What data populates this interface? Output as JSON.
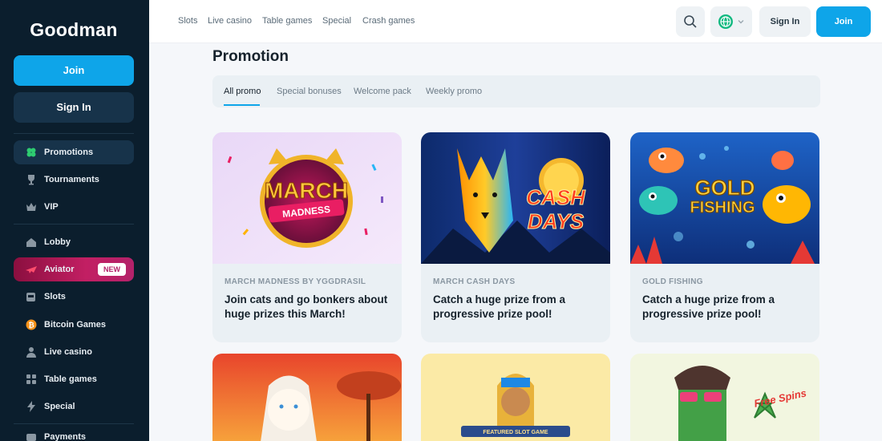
{
  "sidebar": {
    "logo": "Goodman",
    "join_label": "Join",
    "signin_label": "Sign In",
    "items": [
      {
        "label": "Promotions",
        "icon": "clover-icon"
      },
      {
        "label": "Tournaments",
        "icon": "trophy-icon"
      },
      {
        "label": "VIP",
        "icon": "crown-icon"
      },
      {
        "label": "Lobby",
        "icon": "home-icon"
      },
      {
        "label": "Aviator",
        "icon": "plane-icon",
        "badge": "NEW"
      },
      {
        "label": "Slots",
        "icon": "slot-machine-icon"
      },
      {
        "label": "Bitcoin Games",
        "icon": "bitcoin-icon"
      },
      {
        "label": "Live casino",
        "icon": "dealer-icon"
      },
      {
        "label": "Table games",
        "icon": "cards-icon"
      },
      {
        "label": "Special",
        "icon": "lightning-icon"
      },
      {
        "label": "Payments",
        "icon": "wallet-icon"
      }
    ]
  },
  "topnav": {
    "links": [
      "Slots",
      "Live casino",
      "Table games",
      "Special",
      "Crash games"
    ],
    "signin_label": "Sign In",
    "join_label": "Join"
  },
  "main": {
    "title": "Promotion",
    "tabs": [
      "All promo",
      "Special bonuses",
      "Welcome pack",
      "Weekly promo"
    ],
    "cards": [
      {
        "tag": "MARCH MADNESS BY YGGDRASIL",
        "desc": "Join cats and go bonkers about huge prizes this March!",
        "art_text_1": "MARCH",
        "art_text_2": "MADNESS"
      },
      {
        "tag": "MARCH CASH DAYS",
        "desc": "Catch a huge prize from a progressive prize pool!",
        "art_text_1": "CASH",
        "art_text_2": "DAYS"
      },
      {
        "tag": "GOLD FISHING",
        "desc": "Catch a huge prize from a progressive prize pool!",
        "art_text_1": "GOLD",
        "art_text_2": "FISHING"
      }
    ],
    "lower_cards": [
      {
        "art_text": ""
      },
      {
        "art_text": "FEATURED SLOT GAME"
      },
      {
        "art_text": "Free Spins"
      }
    ]
  },
  "colors": {
    "accent": "#0ea5e9",
    "sidebar_bg": "#0b1e2d",
    "aviator": "#c21f63"
  }
}
